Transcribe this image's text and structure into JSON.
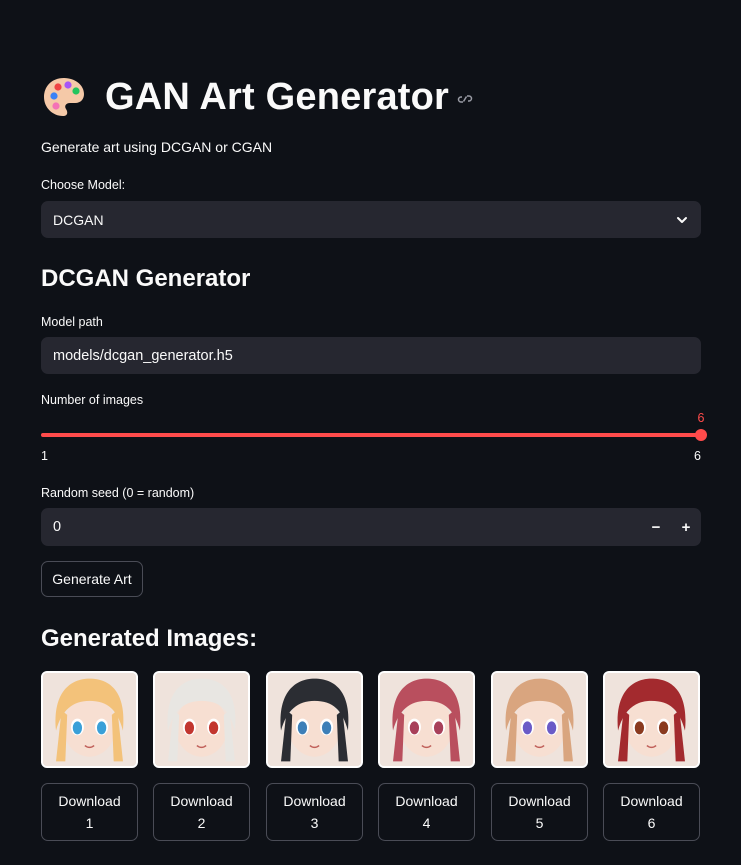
{
  "header": {
    "title": "GAN Art Generator",
    "subtitle": "Generate art using DCGAN or CGAN",
    "icon": "palette-icon"
  },
  "model_select": {
    "label": "Choose Model:",
    "value": "DCGAN"
  },
  "generator": {
    "heading": "DCGAN Generator",
    "model_path_label": "Model path",
    "model_path_value": "models/dcgan_generator.h5",
    "num_images_label": "Number of images",
    "num_images_value": "6",
    "num_images_min": "1",
    "num_images_max": "6",
    "seed_label": "Random seed (0 = random)",
    "seed_value": "0",
    "minus": "−",
    "plus": "+",
    "generate_label": "Generate Art"
  },
  "results": {
    "heading": "Generated Images:",
    "download_label": "Download",
    "images": [
      {
        "index": "1",
        "hair": "#f3c27a",
        "eye": "#3aa0d8"
      },
      {
        "index": "2",
        "hair": "#e8e6e2",
        "eye": "#c2362f"
      },
      {
        "index": "3",
        "hair": "#2b2d33",
        "eye": "#3d7fb8"
      },
      {
        "index": "4",
        "hair": "#b94f5e",
        "eye": "#a8405a"
      },
      {
        "index": "5",
        "hair": "#d9a57f",
        "eye": "#6a5bc7"
      },
      {
        "index": "6",
        "hair": "#a32a2e",
        "eye": "#8a3a1f"
      }
    ]
  },
  "colors": {
    "background": "#0e1117",
    "widget": "#262730",
    "accent": "#ff4b4b",
    "text": "#fafafa"
  }
}
